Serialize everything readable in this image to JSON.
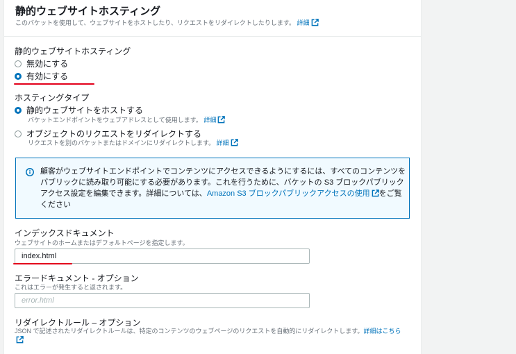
{
  "section": {
    "title": "静的ウェブサイトホスティング",
    "description": "このバケットを使用して、ウェブサイトをホストしたり、リクエストをリダイレクトしたりします。",
    "details_link": "詳細"
  },
  "hosting": {
    "label": "静的ウェブサイトホスティング",
    "options": [
      {
        "label": "無効にする",
        "selected": false
      },
      {
        "label": "有効にする",
        "selected": true
      }
    ]
  },
  "hosting_type": {
    "label": "ホスティングタイプ",
    "options": [
      {
        "label": "静的ウェブサイトをホストする",
        "description": "バケットエンドポイントをウェブアドレスとして使用します。",
        "link": "詳細",
        "selected": true
      },
      {
        "label": "オブジェクトのリクエストをリダイレクトする",
        "description": "リクエストを別のバケットまたはドメインにリダイレクトします。",
        "link": "詳細",
        "selected": false
      }
    ]
  },
  "alert": {
    "text_before": "顧客がウェブサイトエンドポイントでコンテンツにアクセスできるようにするには、すべてのコンテンツをパブリックに読み取り可能にする必要があります。これを行うために、バケットの S3 ブロックパブリックアクセス設定を編集できます。詳細については、",
    "link_text": "Amazon S3 ブロックパブリックアクセスの使用",
    "text_after": "をご覧ください"
  },
  "index_document": {
    "label": "インデックスドキュメント",
    "description": "ウェブサイトのホームまたはデフォルトページを指定します。",
    "value": "index.html"
  },
  "error_document": {
    "label": "エラードキュメント - オプション",
    "description": "これはエラーが発生すると返されます。",
    "placeholder": "error.html"
  },
  "redirect_rules": {
    "label": "リダイレクトルール – オプション",
    "description": "JSON で記述されたリダイレクトルールは、特定のコンテンツのウェブページのリクエストを自動的にリダイレクトします。",
    "link": "詳細はこちら"
  },
  "colors": {
    "accent": "#0073bb",
    "annotation": "#e3001b",
    "alert_bg": "#f1faff"
  }
}
